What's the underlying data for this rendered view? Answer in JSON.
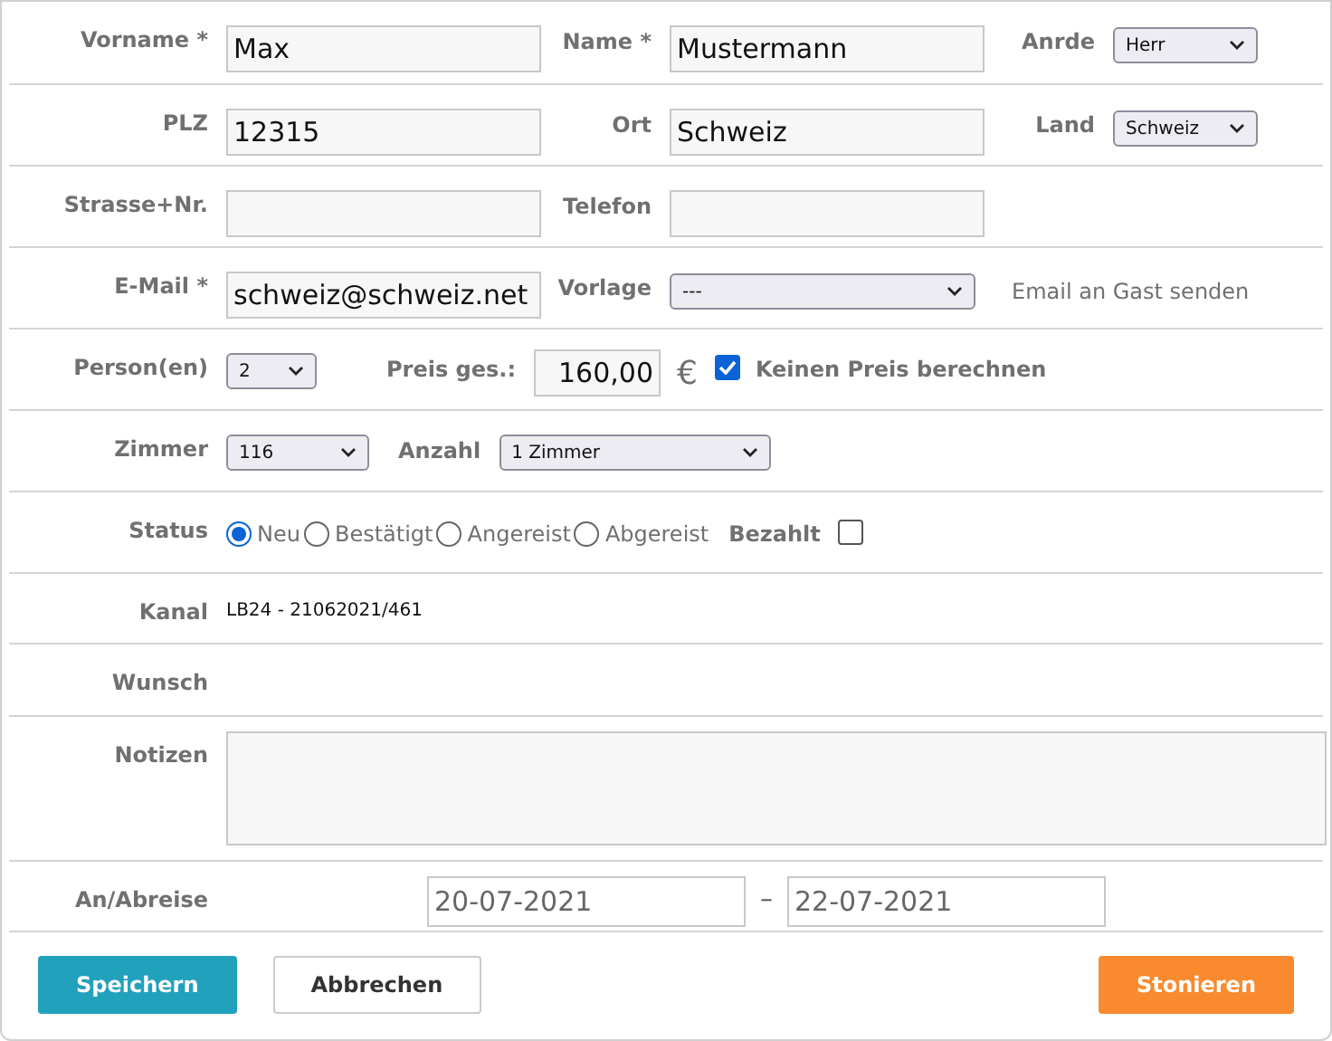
{
  "guest": {
    "first_name": {
      "label": "Vorname *",
      "value": "Max"
    },
    "last_name": {
      "label": "Name *",
      "value": "Mustermann"
    },
    "salutation": {
      "label": "Anrde",
      "value": "Herr"
    },
    "zip": {
      "label": "PLZ",
      "value": "12315"
    },
    "city": {
      "label": "Ort",
      "value": "Schweiz"
    },
    "country": {
      "label": "Land",
      "value": "Schweiz"
    },
    "street": {
      "label": "Strasse+Nr."
    },
    "phone": {
      "label": "Telefon"
    },
    "email": {
      "label": "E-Mail *",
      "value": "schweiz@schweiz.net"
    },
    "template": {
      "label": "Vorlage",
      "value": "---"
    },
    "template_note": "Email an Gast senden"
  },
  "booking": {
    "persons": {
      "label": "Person(en)",
      "value": "2"
    },
    "price": {
      "label": "Preis ges.:",
      "value": "160,00",
      "currency": "€"
    },
    "no_price": {
      "label": "Keinen Preis berechnen",
      "checked": true
    },
    "room": {
      "label": "Zimmer",
      "value": "116"
    },
    "count": {
      "label": "Anzahl",
      "value": "1 Zimmer"
    },
    "status": {
      "label": "Status",
      "options": [
        {
          "label": "Neu",
          "selected": true
        },
        {
          "label": "Bestätigt",
          "selected": false
        },
        {
          "label": "Angereist",
          "selected": false
        },
        {
          "label": "Abgereist",
          "selected": false
        }
      ]
    },
    "paid": {
      "label": "Bezahlt",
      "checked": false
    },
    "channel": {
      "label": "Kanal",
      "value": "LB24 - 21062021/461"
    },
    "wish": {
      "label": "Wunsch"
    },
    "notes": {
      "label": "Notizen"
    },
    "dates": {
      "label": "An/Abreise",
      "arrival": "20-07-2021",
      "separator": "–",
      "departure": "22-07-2021"
    }
  },
  "buttons": [
    {
      "label": "Speichern",
      "kind": "primary"
    },
    {
      "label": "Abbrechen",
      "kind": "secondary"
    },
    {
      "label": "Stonieren",
      "kind": "danger"
    }
  ]
}
